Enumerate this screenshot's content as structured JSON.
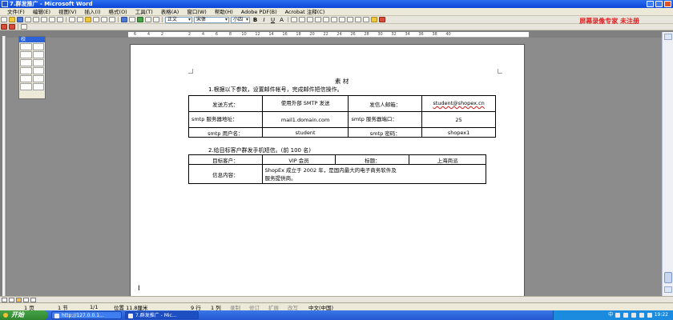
{
  "window": {
    "title": "7.群发推广 - Microsoft Word"
  },
  "menu": [
    "文件(F)",
    "编辑(E)",
    "视图(V)",
    "插入(I)",
    "格式(O)",
    "工具(T)",
    "表格(A)",
    "窗口(W)",
    "帮助(H)",
    "Adobe PDF(B)",
    "Acrobat 注释(C)"
  ],
  "toolbar": {
    "style_value": "正文",
    "font_value": "宋体",
    "size_value": "小四",
    "bold": "B",
    "italic": "I",
    "underline": "U",
    "strike": "A",
    "promo": "屏幕录像专家 未注册"
  },
  "ruler": {
    "marks": [
      "6",
      "4",
      "2",
      "",
      "2",
      "4",
      "6",
      "8",
      "10",
      "12",
      "14",
      "16",
      "18",
      "20",
      "22",
      "24",
      "26",
      "28",
      "30",
      "32",
      "34",
      "36",
      "38",
      "40"
    ]
  },
  "palette": {
    "title": "校"
  },
  "document": {
    "title": "素  材",
    "p1": "1.根据以下参数，设置邮件帐号，完成邮件短信操作。",
    "table1": [
      [
        {
          "t": "发送方式："
        },
        {
          "t": "使用外部 SMTP 发送"
        },
        {
          "t": "发信人邮箱："
        },
        {
          "t": "student@shopex.cn"
        }
      ],
      [
        {
          "t": "smtp 服务器地址："
        },
        {
          "t": "mail1.domain.com"
        },
        {
          "t": "smtp 服务器端口："
        },
        {
          "t": "25"
        }
      ],
      [
        {
          "t": "smtp 用户名："
        },
        {
          "t": "student"
        },
        {
          "t": "smtp 密码："
        },
        {
          "t": "shopex1"
        }
      ]
    ],
    "p2": "2.给目标客户群发手机短信。(前 100 名)",
    "table2": {
      "r1": [
        "目标客户：",
        "VIP 会员",
        "标题：",
        "上海商派"
      ],
      "r2_label": "信息内容：",
      "r2_line1": "ShopEx 成立于 2002 年，是国内最大的电子商务软件及",
      "r2_line2": "服务提供商。"
    }
  },
  "status": {
    "page": "1 页",
    "section": "1 节",
    "pages": "1/1",
    "position": "位置 11.8厘米",
    "row": "9 行",
    "col": "1 列",
    "rec": "录制",
    "trk": "修订",
    "ext": "扩展",
    "ovr": "改写",
    "lang": "中文(中国)"
  },
  "taskbar": {
    "start": "开始",
    "items": [
      "http://127.0.0.1...",
      "7.群发推广 - Mic..."
    ],
    "clock": "19:22",
    "ime": "中"
  }
}
